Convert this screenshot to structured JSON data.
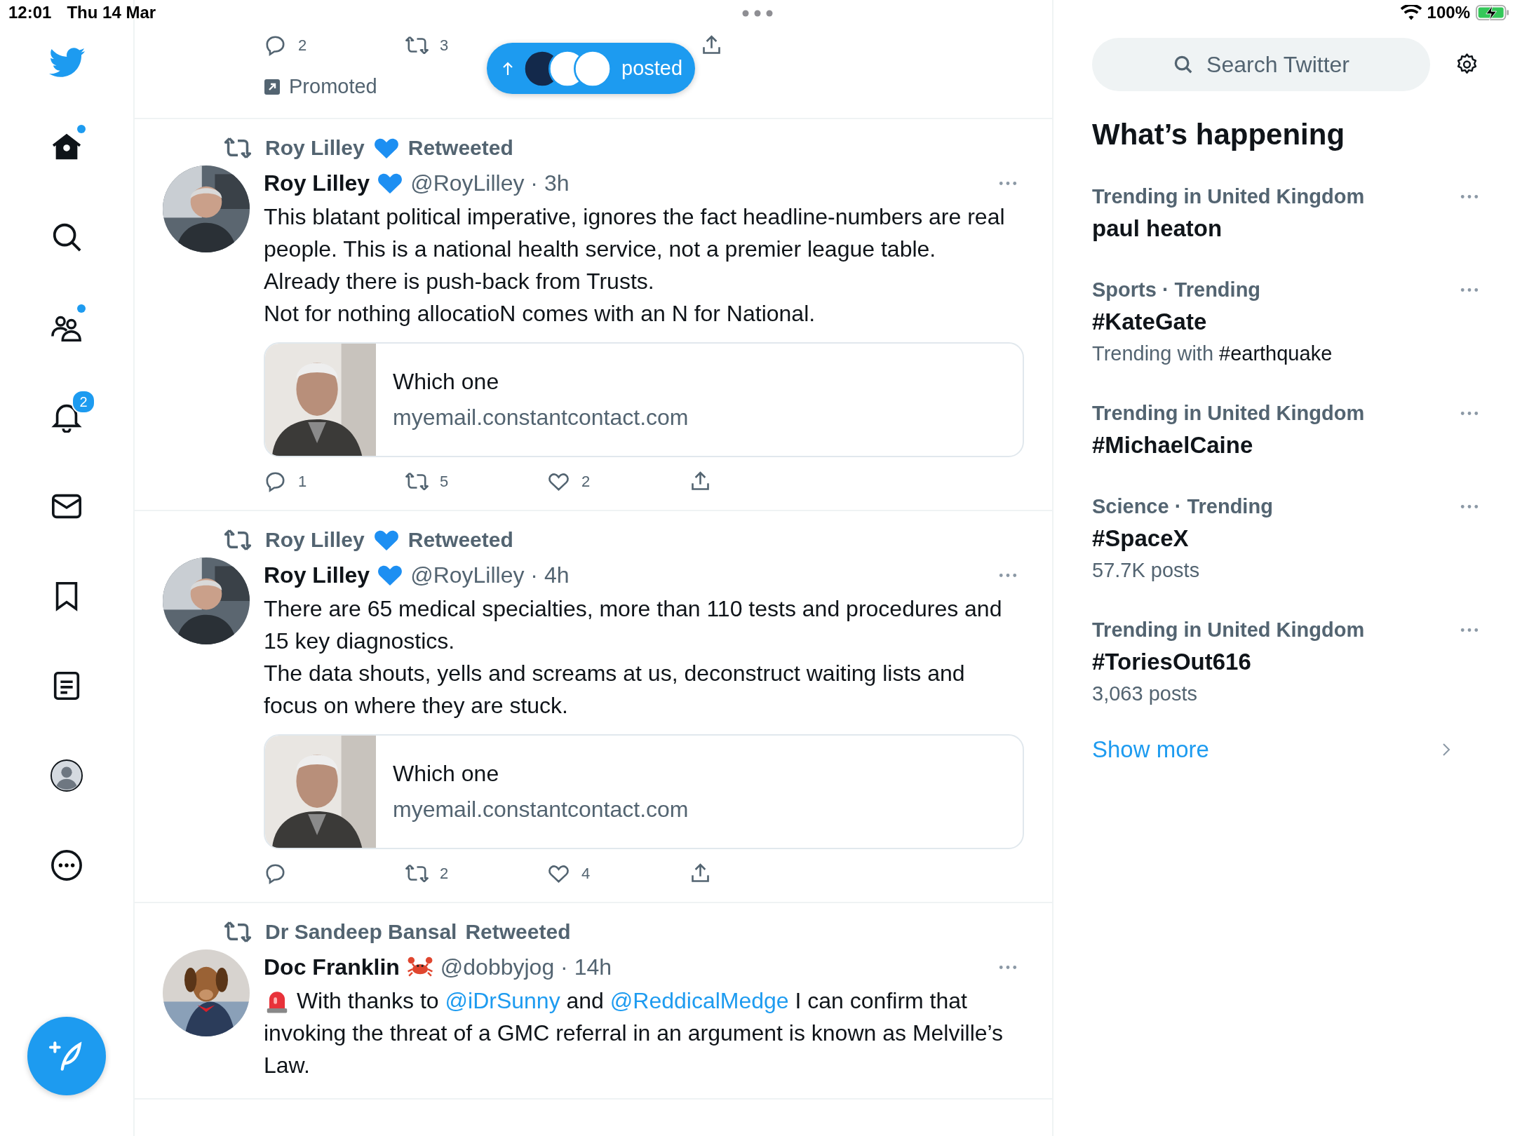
{
  "status_bar": {
    "time": "12:01",
    "date": "Thu 14 Mar",
    "battery": "100%",
    "charging": true
  },
  "nav": {
    "items": [
      {
        "kind": "home",
        "unread": true
      },
      {
        "kind": "search",
        "unread": false
      },
      {
        "kind": "communities",
        "unread": true
      },
      {
        "kind": "notifications",
        "badge": "2"
      },
      {
        "kind": "messages",
        "unread": false
      },
      {
        "kind": "bookmarks",
        "unread": false
      },
      {
        "kind": "lists",
        "unread": false
      },
      {
        "kind": "profile",
        "unread": false
      },
      {
        "kind": "more",
        "unread": false
      }
    ]
  },
  "promoted_tweet": {
    "replies": "2",
    "retweets": "3",
    "label": "Promoted"
  },
  "new_posts_pill": {
    "label": "posted",
    "avatars": [
      {
        "color": "#13294b"
      },
      {
        "color": "#ffffff"
      },
      {
        "color": "#ffffff"
      }
    ]
  },
  "tweets": [
    {
      "retweeter": "Roy Lilley",
      "retweeter_emoji": {
        "kind": "blue-heart"
      },
      "retweet_label": "Retweeted",
      "name": "Roy Lilley",
      "name_emoji": {
        "kind": "blue-heart"
      },
      "meta": "@RoyLilley · 3h",
      "avatar": {
        "kind": "man"
      },
      "paragraphs": [
        [
          {
            "kind": "text",
            "text": "This blatant political imperative, ignores the fact headline-numbers are real people. This is a national health service, not a premier league table."
          }
        ],
        [
          {
            "kind": "text",
            "text": "Already there is push-back from Trusts."
          }
        ],
        [
          {
            "kind": "text",
            "text": "Not for nothing allocatioN comes with an N for National."
          }
        ]
      ],
      "card": {
        "title": "Which one",
        "domain": "myemail.constantcontact.com"
      },
      "stats": {
        "replies": "1",
        "retweets": "5",
        "likes": "2"
      }
    },
    {
      "retweeter": "Roy Lilley",
      "retweeter_emoji": {
        "kind": "blue-heart"
      },
      "retweet_label": "Retweeted",
      "name": "Roy Lilley",
      "name_emoji": {
        "kind": "blue-heart"
      },
      "meta": "@RoyLilley · 4h",
      "avatar": {
        "kind": "man"
      },
      "paragraphs": [
        [
          {
            "kind": "text",
            "text": "There are 65 medical specialties, more than 110 tests and procedures and 15 key diagnostics."
          }
        ],
        [
          {
            "kind": "text",
            "text": "The data shouts, yells and screams at us, deconstruct waiting lists and focus on where they are stuck."
          }
        ]
      ],
      "card": {
        "title": "Which one",
        "domain": "myemail.constantcontact.com"
      },
      "stats": {
        "retweets": "2",
        "likes": "4"
      }
    },
    {
      "retweeter": "Dr Sandeep Bansal",
      "retweet_label": "Retweeted",
      "name": "Doc Franklin",
      "name_emoji": {
        "kind": "crab"
      },
      "meta": "@dobbyjog · 14h",
      "avatar": {
        "kind": "dog"
      },
      "paragraphs": [
        [
          {
            "kind": "siren"
          },
          {
            "kind": "text",
            "text": " With thanks to "
          },
          {
            "kind": "mention",
            "text": "@iDrSunny"
          },
          {
            "kind": "text",
            "text": " and "
          },
          {
            "kind": "mention",
            "text": "@ReddicalMedge"
          },
          {
            "kind": "text",
            "text": " I can confirm that invoking the threat of a GMC referral in an argument is known as Melville’s Law."
          }
        ]
      ]
    }
  ],
  "sidebar": {
    "search_placeholder": "Search Twitter",
    "heading": "What’s happening",
    "trends": [
      {
        "context": "Trending in United Kingdom",
        "topic": "paul heaton"
      },
      {
        "context": "Sports · Trending",
        "topic": "#KateGate",
        "note": "Trending with",
        "note_tag": "#earthquake"
      },
      {
        "context": "Trending in United Kingdom",
        "topic": "#MichaelCaine"
      },
      {
        "context": "Science · Trending",
        "topic": "#SpaceX",
        "posts": "57.7K posts"
      },
      {
        "context": "Trending in United Kingdom",
        "topic": "#ToriesOut616",
        "posts": "3,063 posts"
      }
    ],
    "show_more": "Show more"
  }
}
